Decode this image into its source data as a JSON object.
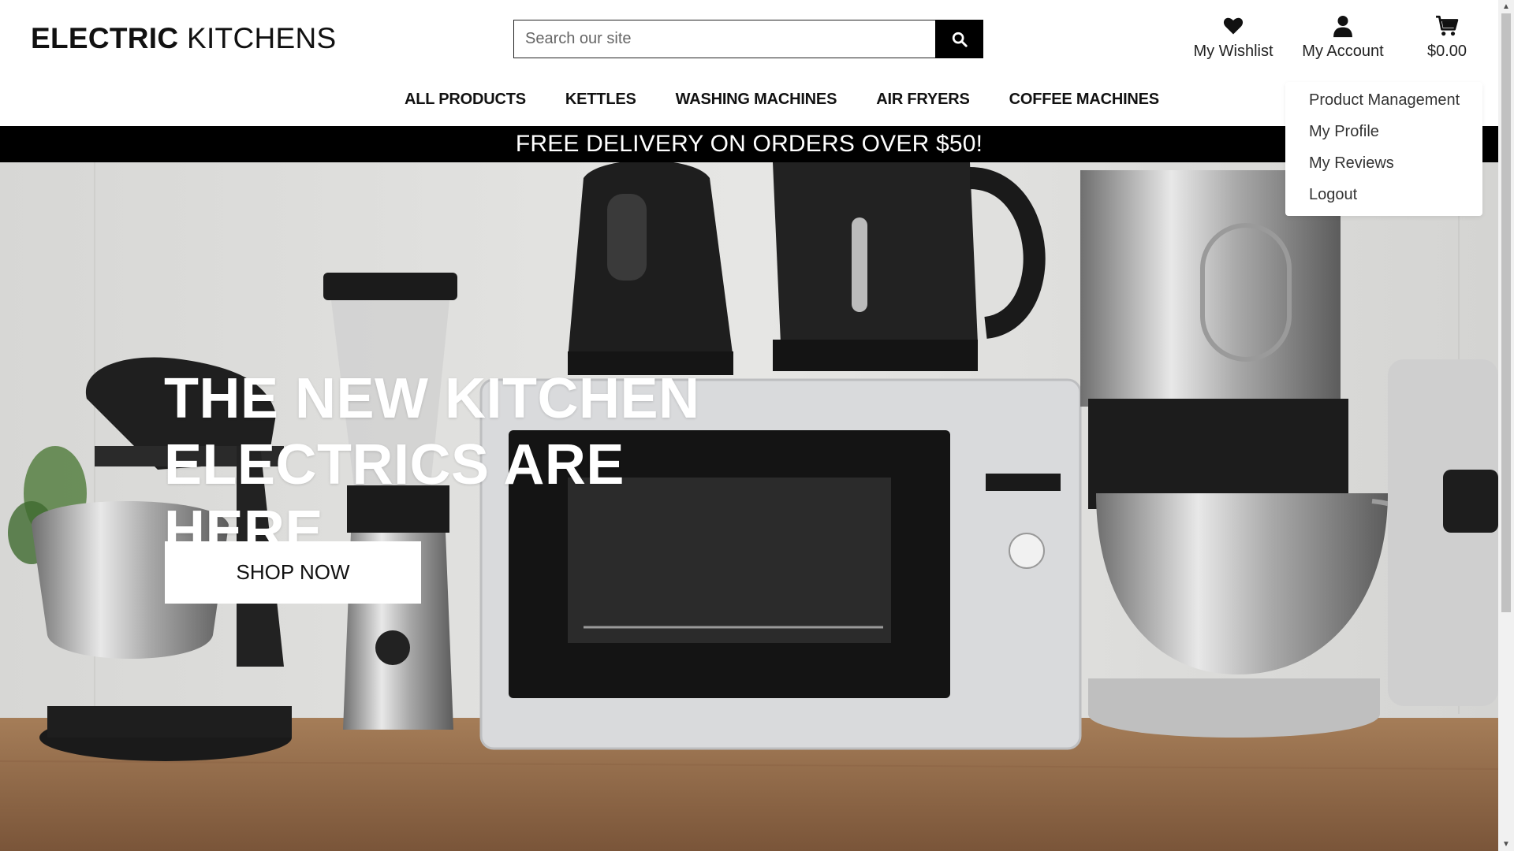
{
  "header": {
    "logo_bold": "ELECTRIC",
    "logo_rest": " KITCHENS",
    "search_placeholder": "Search our site",
    "wishlist_label": "My Wishlist",
    "account_label": "My Account",
    "cart_total": "$0.00"
  },
  "nav": {
    "items": [
      {
        "label": "All Products"
      },
      {
        "label": "Kettles"
      },
      {
        "label": "Washing Machines"
      },
      {
        "label": "Air Fryers"
      },
      {
        "label": "Coffee Machines"
      }
    ]
  },
  "banner": {
    "text": "FREE DELIVERY ON ORDERS OVER $50!"
  },
  "hero": {
    "title_line1": "The new kitchen",
    "title_line2": "electrics are here",
    "cta_label": "Shop Now"
  },
  "account_menu": {
    "items": [
      {
        "label": "Product Management"
      },
      {
        "label": "My Profile"
      },
      {
        "label": "My Reviews"
      },
      {
        "label": "Logout"
      }
    ]
  },
  "icons": {
    "search": "search-icon",
    "wishlist": "heart-icon",
    "account": "user-icon",
    "cart": "cart-icon"
  },
  "colors": {
    "banner_bg": "#000000",
    "text": "#111111",
    "hero_text": "#ffffff"
  }
}
